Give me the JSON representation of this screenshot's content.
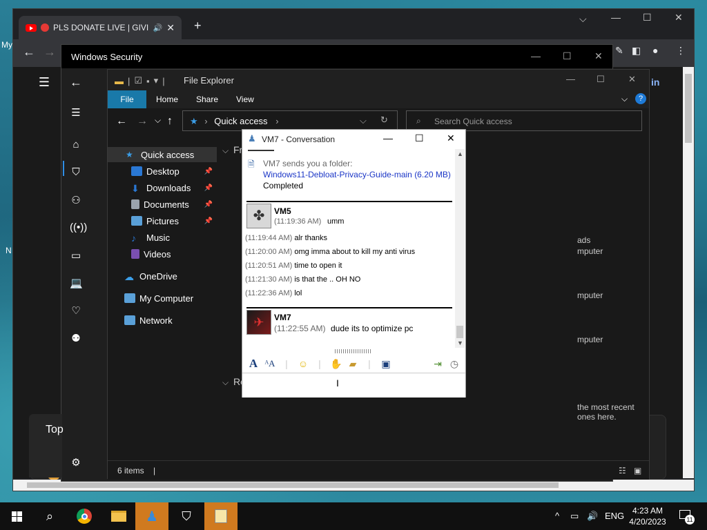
{
  "desktop": {
    "fragments": [
      "My",
      "N"
    ]
  },
  "chrome": {
    "tab_title": "PLS DONATE LIVE | GIVIN",
    "new_tab_icon": "+",
    "toolbar_right": [
      "extensions-icon",
      "sidebar-icon",
      "profile-icon",
      "menu-icon"
    ],
    "partial_right_label": "in"
  },
  "security": {
    "title": "Windows Security",
    "top_card_text": "Top",
    "nav_icons": [
      "back-icon",
      "menu-icon",
      "home-icon",
      "shield-icon",
      "person-icon",
      "wifi-icon",
      "browser-icon",
      "laptop-icon",
      "heart-icon",
      "family-icon",
      "settings-icon"
    ]
  },
  "explorer": {
    "title": "File Explorer",
    "ribbon": {
      "file": "File",
      "home": "Home",
      "share": "Share",
      "view": "View"
    },
    "address": "Quick access",
    "search_placeholder": "Search Quick access",
    "tree": [
      {
        "label": "Quick access",
        "icon": "star-icon",
        "color": "#3b9ee8",
        "pinned": false,
        "selected": true
      },
      {
        "label": "Desktop",
        "icon": "desktop-folder-icon",
        "color": "#2a78d4",
        "pinned": true
      },
      {
        "label": "Downloads",
        "icon": "download-icon",
        "color": "#2a78d4",
        "pinned": true
      },
      {
        "label": "Documents",
        "icon": "document-icon",
        "color": "#9aa3ad",
        "pinned": true
      },
      {
        "label": "Pictures",
        "icon": "pictures-icon",
        "color": "#5aa0d8",
        "pinned": true
      },
      {
        "label": "Music",
        "icon": "music-icon",
        "color": "#2a78d4",
        "pinned": false
      },
      {
        "label": "Videos",
        "icon": "videos-icon",
        "color": "#7a4fb0",
        "pinned": false
      },
      {
        "label": "OneDrive",
        "icon": "cloud-icon",
        "color": "#3b9ee8",
        "pinned": false
      },
      {
        "label": "My Computer",
        "icon": "computer-icon",
        "color": "#5aa0d8",
        "pinned": false
      },
      {
        "label": "Network",
        "icon": "network-icon",
        "color": "#5aa0d8",
        "pinned": false
      }
    ],
    "sections": {
      "frequent": "Fr",
      "recent": "Re"
    },
    "partial_texts": [
      "ads",
      "mputer",
      "mputer",
      "mputer",
      "the most recent ones here."
    ],
    "status": "6 items"
  },
  "conversation": {
    "title": "VM7 - Conversation",
    "transfer": {
      "intro": "VM7 sends you a folder:",
      "file": "Windows11-Debloat-Privacy-Guide-main (6.20 MB)",
      "status": "Completed"
    },
    "block1": {
      "sender": "VM5",
      "first_time": "(11:19:36 AM)",
      "first_text": "umm",
      "lines": [
        {
          "time": "(11:19:44 AM)",
          "text": "alr thanks"
        },
        {
          "time": "(11:20:00 AM)",
          "text": "omg imma about to kill my anti virus"
        },
        {
          "time": "(11:20:51 AM)",
          "text": "time to open it"
        },
        {
          "time": "(11:21:30 AM)",
          "text": "is that the .. OH NO"
        },
        {
          "time": "(11:22:36 AM)",
          "text": "lol"
        }
      ]
    },
    "block2": {
      "sender": "VM7",
      "time": "(11:22:55 AM)",
      "text": "dude its to optimize pc"
    }
  },
  "taskbar": {
    "apps": [
      "start-icon",
      "search-icon",
      "chrome-icon",
      "file-explorer-icon",
      "messenger-icon",
      "windows-security-icon",
      "notes-icon"
    ],
    "language": "ENG",
    "time": "4:23 AM",
    "date": "4/20/2023",
    "notification_count": "11"
  }
}
